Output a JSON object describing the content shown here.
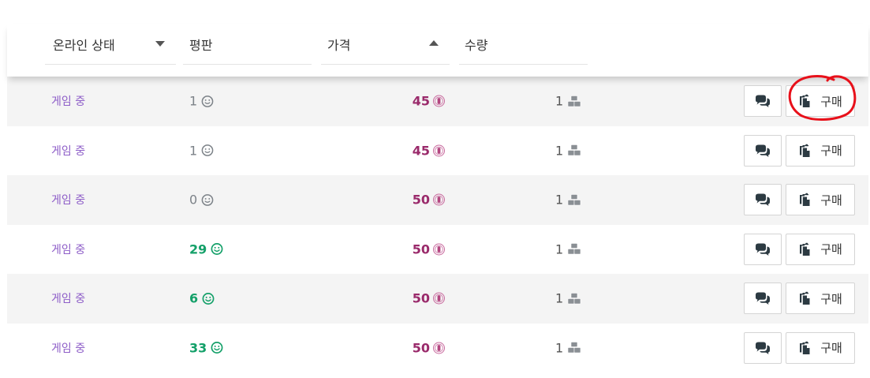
{
  "header": {
    "columns": [
      {
        "label": "온라인 상태",
        "sort": "desc"
      },
      {
        "label": "평판"
      },
      {
        "label": "가격",
        "sort": "asc"
      },
      {
        "label": "수량"
      }
    ]
  },
  "rows": [
    {
      "status": "게임 중",
      "reputation": "1",
      "rep_style": "grey",
      "price": "45",
      "quantity": "1",
      "buy_label": "구매"
    },
    {
      "status": "게임 중",
      "reputation": "1",
      "rep_style": "grey",
      "price": "45",
      "quantity": "1",
      "buy_label": "구매"
    },
    {
      "status": "게임 중",
      "reputation": "0",
      "rep_style": "grey",
      "price": "50",
      "quantity": "1",
      "buy_label": "구매"
    },
    {
      "status": "게임 중",
      "reputation": "29",
      "rep_style": "green",
      "price": "50",
      "quantity": "1",
      "buy_label": "구매"
    },
    {
      "status": "게임 중",
      "reputation": "6",
      "rep_style": "green",
      "price": "50",
      "quantity": "1",
      "buy_label": "구매"
    },
    {
      "status": "게임 중",
      "reputation": "33",
      "rep_style": "green",
      "price": "50",
      "quantity": "1",
      "buy_label": "구매"
    }
  ],
  "icons": {
    "reputation": "smiley-icon",
    "price": "platinum-coin-icon",
    "quantity": "cubes-icon",
    "chat": "comments-icon",
    "buy": "copy-icon",
    "sort_desc": "caret-down-icon",
    "sort_asc": "caret-up-icon"
  },
  "colors": {
    "status": "#8e5ec8",
    "rep_grey": "#7c8288",
    "rep_green": "#14a069",
    "price": "#9a2a6b",
    "alt_row": "#f4f4f4",
    "annotation": "#e8101a"
  },
  "annotation": {
    "type": "hand-drawn-circle",
    "target": "row-1-buy-button"
  }
}
